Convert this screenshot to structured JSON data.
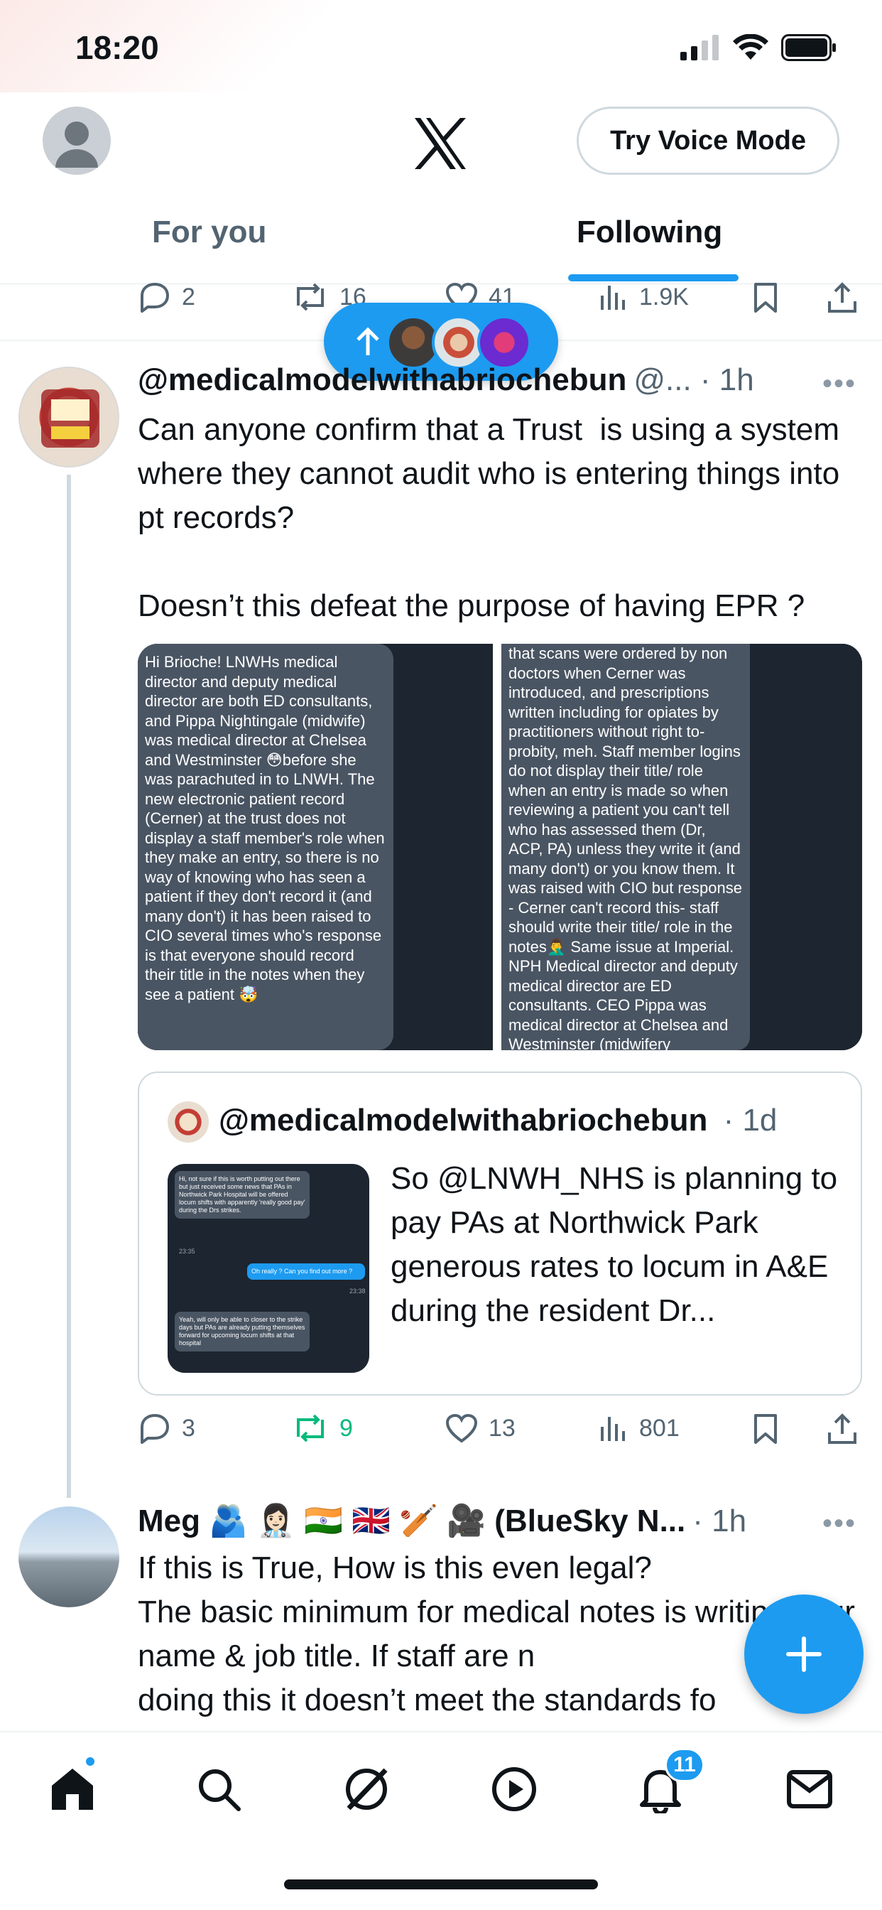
{
  "status": {
    "time": "18:20"
  },
  "header": {
    "voice_button": "Try Voice Mode",
    "tabs": [
      {
        "label": "For you"
      },
      {
        "label": "Following"
      }
    ]
  },
  "prev_tweet_actions": {
    "replies": "2",
    "reposts": "16",
    "likes": "41",
    "views": "1.9K"
  },
  "tweet1": {
    "handle_name": "@medicalmodelwithabriochebun",
    "meta": "@... · 1h",
    "text": "Can anyone confirm that a Trust  is using a system where they cannot audit who is entering things into pt records?\n\nDoesn’t this defeat the purpose of having EPR ?",
    "image_left_text": "Hi Brioche! LNWHs medical director and deputy medical director are both ED consultants, and Pippa Nightingale (midwife) was medical director at Chelsea and Westminster 😳before she was parachuted in to LNWH. The new electronic patient record (Cerner) at the trust does not display a staff member's role when they make an entry, so there is no way of knowing who has seen a patient if they don't record it (and many don't) it has been raised to CIO several times who's response is that everyone should record their title in the notes when they see a patient 🤯",
    "image_right_text": "that scans were ordered by non doctors when Cerner was introduced, and prescriptions written including for opiates by practitioners without right to- probity, meh. Staff member logins do not display their title/ role when an entry is made so when reviewing a patient you can't tell who has assessed them (Dr, ACP, PA) unless they write it (and many don't) or you know them. It was raised with CIO but response - Cerner can't record this- staff should write their title/ role in the notes🤦‍♂️ Same issue at Imperial.  NPH Medical director and deputy medical director are ED consultants. CEO Pippa was medical director at Chelsea and Westminster (midwifery background!) before moved to",
    "quote": {
      "name": "@medicalmodelwithabriochebun",
      "meta": "· 1d",
      "text": "So @LNWH_NHS is planning to pay PAs at Northwick Park generous rates to locum in A&E during the resident Dr...",
      "img_msg1": "Hi, not sure if this is worth putting out there but just received some news that PAs in Northwick Park Hospital will be offered locum shifts with apparently 'really good pay' during the Drs strikes.",
      "img_time1": "23:35",
      "img_msg2": "Oh really ? Can you find out more ?",
      "img_time2": "23:38",
      "img_msg3": "Yeah, will only be able to closer to the strike days but PAs are already putting themselves forward for upcoming locum shifts at that hospital"
    },
    "actions": {
      "replies": "3",
      "reposts": "9",
      "likes": "13",
      "views": "801"
    }
  },
  "tweet2": {
    "name": "Meg 🫂 👩🏻‍⚕️ 🇮🇳 🇬🇧 🏏 🎥 (BlueSky N...",
    "meta": "· 1h",
    "text": "If this is True, How is this even legal?\nThe basic minimum for medical notes is writing your name & job title. If staff are n\ndoing this it doesn’t meet the standards fo"
  },
  "nav": {
    "notifications_badge": "11"
  },
  "colors": {
    "accent": "#1d9bf0",
    "repost_active": "#00ba7c"
  }
}
